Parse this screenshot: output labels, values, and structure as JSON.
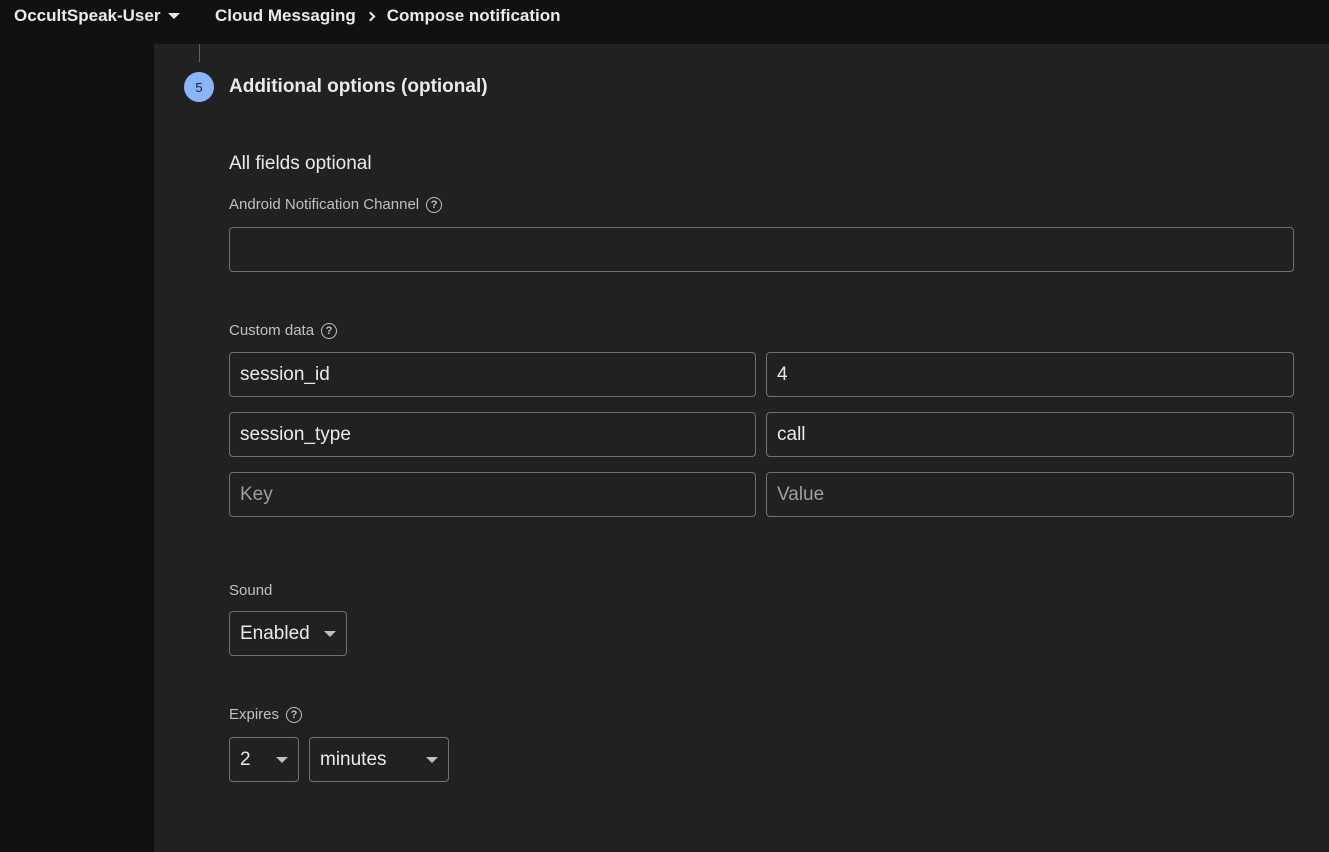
{
  "header": {
    "project_name": "OccultSpeak-User",
    "breadcrumb": [
      "Cloud Messaging",
      "Compose notification"
    ]
  },
  "step": {
    "number": "5",
    "title": "Additional options (optional)",
    "subtitle": "All fields optional"
  },
  "android_channel": {
    "label": "Android Notification Channel",
    "value": ""
  },
  "custom_data": {
    "label": "Custom data",
    "rows": [
      {
        "key": "session_id",
        "value": "4"
      },
      {
        "key": "session_type",
        "value": "call"
      }
    ],
    "key_placeholder": "Key",
    "value_placeholder": "Value"
  },
  "sound": {
    "label": "Sound",
    "selected": "Enabled"
  },
  "expires": {
    "label": "Expires",
    "amount": "2",
    "unit": "minutes"
  },
  "icons": {
    "help": "help-circle-icon",
    "dropdown": "chevron-down-icon",
    "breadcrumb_separator": "chevron-right-icon"
  }
}
